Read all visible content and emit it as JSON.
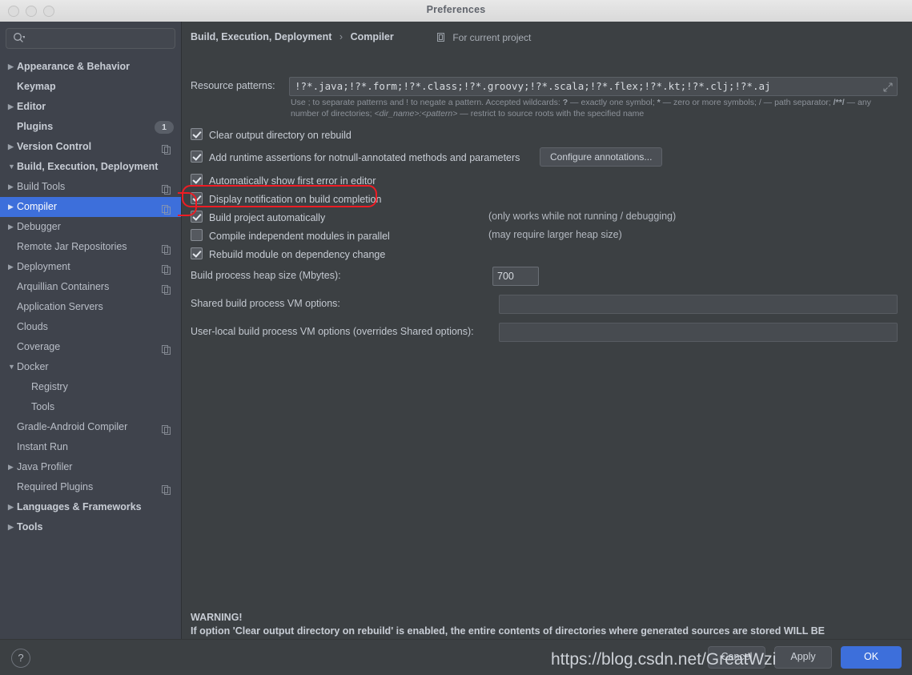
{
  "window": {
    "title": "Preferences",
    "traffic_lights": [
      "close-button",
      "minimize-button",
      "zoom-button"
    ]
  },
  "sidebar": {
    "search": {
      "value": "",
      "placeholder": ""
    },
    "items": [
      {
        "label": "Appearance & Behavior",
        "indent": 0,
        "arrow": "collapsed",
        "bold": true,
        "badge": "",
        "copy": false,
        "selected": false
      },
      {
        "label": "Keymap",
        "indent": 0,
        "arrow": "none",
        "bold": true,
        "badge": "",
        "copy": false,
        "selected": false
      },
      {
        "label": "Editor",
        "indent": 0,
        "arrow": "collapsed",
        "bold": true,
        "badge": "",
        "copy": false,
        "selected": false
      },
      {
        "label": "Plugins",
        "indent": 0,
        "arrow": "none",
        "bold": true,
        "badge": "1",
        "copy": false,
        "selected": false
      },
      {
        "label": "Version Control",
        "indent": 0,
        "arrow": "collapsed",
        "bold": true,
        "badge": "",
        "copy": true,
        "selected": false
      },
      {
        "label": "Build, Execution, Deployment",
        "indent": 0,
        "arrow": "expanded",
        "bold": true,
        "badge": "",
        "copy": false,
        "selected": false
      },
      {
        "label": "Build Tools",
        "indent": 1,
        "arrow": "collapsed",
        "bold": false,
        "badge": "",
        "copy": true,
        "selected": false
      },
      {
        "label": "Compiler",
        "indent": 1,
        "arrow": "collapsed",
        "bold": false,
        "badge": "",
        "copy": true,
        "selected": true
      },
      {
        "label": "Debugger",
        "indent": 1,
        "arrow": "collapsed",
        "bold": false,
        "badge": "",
        "copy": false,
        "selected": false
      },
      {
        "label": "Remote Jar Repositories",
        "indent": 1,
        "arrow": "none",
        "bold": false,
        "badge": "",
        "copy": true,
        "selected": false
      },
      {
        "label": "Deployment",
        "indent": 1,
        "arrow": "collapsed",
        "bold": false,
        "badge": "",
        "copy": true,
        "selected": false
      },
      {
        "label": "Arquillian Containers",
        "indent": 1,
        "arrow": "none",
        "bold": false,
        "badge": "",
        "copy": true,
        "selected": false
      },
      {
        "label": "Application Servers",
        "indent": 1,
        "arrow": "none",
        "bold": false,
        "badge": "",
        "copy": false,
        "selected": false
      },
      {
        "label": "Clouds",
        "indent": 1,
        "arrow": "none",
        "bold": false,
        "badge": "",
        "copy": false,
        "selected": false
      },
      {
        "label": "Coverage",
        "indent": 1,
        "arrow": "none",
        "bold": false,
        "badge": "",
        "copy": true,
        "selected": false
      },
      {
        "label": "Docker",
        "indent": 1,
        "arrow": "expanded",
        "bold": false,
        "badge": "",
        "copy": false,
        "selected": false
      },
      {
        "label": "Registry",
        "indent": 2,
        "arrow": "none",
        "bold": false,
        "badge": "",
        "copy": false,
        "selected": false
      },
      {
        "label": "Tools",
        "indent": 2,
        "arrow": "none",
        "bold": false,
        "badge": "",
        "copy": false,
        "selected": false
      },
      {
        "label": "Gradle-Android Compiler",
        "indent": 1,
        "arrow": "none",
        "bold": false,
        "badge": "",
        "copy": true,
        "selected": false
      },
      {
        "label": "Instant Run",
        "indent": 1,
        "arrow": "none",
        "bold": false,
        "badge": "",
        "copy": false,
        "selected": false
      },
      {
        "label": "Java Profiler",
        "indent": 1,
        "arrow": "collapsed",
        "bold": false,
        "badge": "",
        "copy": false,
        "selected": false
      },
      {
        "label": "Required Plugins",
        "indent": 1,
        "arrow": "none",
        "bold": false,
        "badge": "",
        "copy": true,
        "selected": false
      },
      {
        "label": "Languages & Frameworks",
        "indent": 0,
        "arrow": "collapsed",
        "bold": true,
        "badge": "",
        "copy": false,
        "selected": false
      },
      {
        "label": "Tools",
        "indent": 0,
        "arrow": "collapsed",
        "bold": true,
        "badge": "",
        "copy": false,
        "selected": false
      }
    ]
  },
  "main": {
    "breadcrumb": {
      "parent": "Build, Execution, Deployment",
      "separator": "›",
      "current": "Compiler"
    },
    "scope_label": "For current project",
    "resource_patterns": {
      "label": "Resource patterns:",
      "value": "!?*.java;!?*.form;!?*.class;!?*.groovy;!?*.scala;!?*.flex;!?*.kt;!?*.clj;!?*.aj",
      "hint_line1_a": "Use ; to separate patterns and ! to negate a pattern. Accepted wildcards: ",
      "hint_q": "?",
      "hint_line1_b": " — exactly one symbol; ",
      "hint_star": "*",
      "hint_line1_c": " — zero or more symbols; / — path separator; ",
      "hint_globstar": "/**/",
      "hint_line1_d": " —",
      "hint_line2_a": "any number of directories; ",
      "hint_dir": "<dir_name>:<pattern>",
      "hint_line2_b": " — restrict to source roots with the specified name"
    },
    "checkboxes": [
      {
        "label": "Clear output directory on rebuild",
        "checked": true,
        "note": ""
      },
      {
        "label": "Add runtime assertions for notnull-annotated methods and parameters",
        "checked": true,
        "note": ""
      },
      {
        "label": "Automatically show first error in editor",
        "checked": true,
        "note": ""
      },
      {
        "label": "Display notification on build completion",
        "checked": true,
        "note": ""
      },
      {
        "label": "Build project automatically",
        "checked": true,
        "note": "(only works while not running / debugging)"
      },
      {
        "label": "Compile independent modules in parallel",
        "checked": false,
        "note": "(may require larger heap size)"
      },
      {
        "label": "Rebuild module on dependency change",
        "checked": true,
        "note": ""
      }
    ],
    "configure_annotations_button": "Configure annotations...",
    "heap": {
      "label": "Build process heap size (Mbytes):",
      "value": "700"
    },
    "shared_vm": {
      "label": "Shared build process VM options:",
      "value": "",
      "placeholder": ""
    },
    "user_vm": {
      "label": "User-local build process VM options (overrides Shared options):",
      "value": "",
      "placeholder": ""
    },
    "warning": {
      "title": "WARNING!",
      "body": "If option 'Clear output directory on rebuild' is enabled, the entire contents of directories where generated sources are stored WILL BE CLEARED on rebuild."
    }
  },
  "footer": {
    "help_label": "?",
    "buttons": [
      {
        "label": "Cancel",
        "primary": false
      },
      {
        "label": "Apply",
        "primary": false
      },
      {
        "label": "OK",
        "primary": true
      }
    ]
  },
  "watermark": {
    "text": "https://blog.csdn.net/GreatWzi"
  },
  "annotations": {
    "highlight_color": "#ee1c24",
    "boxes": [
      {
        "name": "build-project-automatically-highlight"
      },
      {
        "name": "compiler-sidebar-highlight"
      }
    ]
  }
}
